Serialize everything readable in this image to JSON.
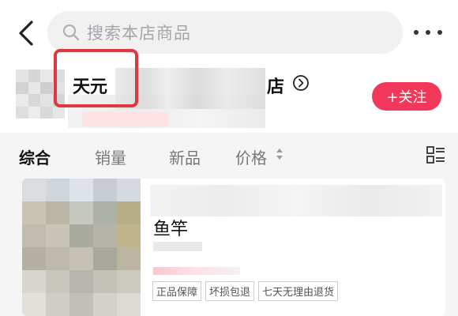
{
  "search": {
    "placeholder": "搜索本店商品",
    "icon": "search-icon"
  },
  "nav": {
    "back_icon": "chevron-left-icon",
    "more_icon": "more-dots-icon"
  },
  "store": {
    "name_start": "天元",
    "name_end": "店",
    "follow_label": "+关注",
    "arrow_icon": "chevron-right-circle-icon"
  },
  "tabs": [
    {
      "label": "综合",
      "active": true
    },
    {
      "label": "销量",
      "active": false
    },
    {
      "label": "新品",
      "active": false
    },
    {
      "label": "价格",
      "active": false
    }
  ],
  "product": {
    "title": "鱼竿",
    "tags": [
      "正品保障",
      "坏损包退",
      "七天无理由退货"
    ]
  },
  "colors": {
    "accent": "#f2385a",
    "highlight": "#e0383e",
    "background": "#f5f5f5"
  }
}
